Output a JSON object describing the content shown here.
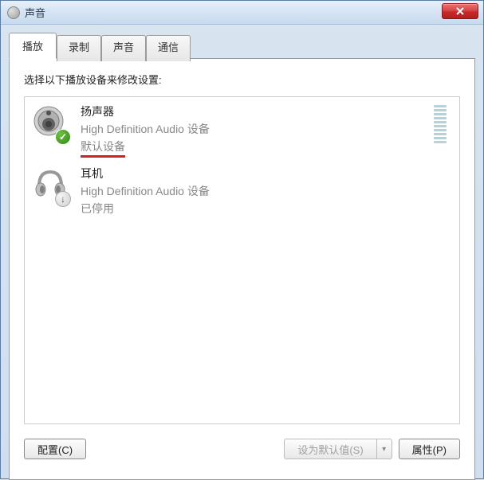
{
  "window": {
    "title": "声音"
  },
  "tabs": [
    {
      "label": "播放",
      "active": true
    },
    {
      "label": "录制",
      "active": false
    },
    {
      "label": "声音",
      "active": false
    },
    {
      "label": "通信",
      "active": false
    }
  ],
  "instruction": "选择以下播放设备来修改设置:",
  "devices": [
    {
      "name": "扬声器",
      "description": "High Definition Audio 设备",
      "status": "默认设备",
      "status_highlight": true,
      "badge": "check",
      "icon": "speaker",
      "show_meter": true
    },
    {
      "name": "耳机",
      "description": "High Definition Audio 设备",
      "status": "已停用",
      "status_highlight": false,
      "badge": "down",
      "icon": "headphones",
      "show_meter": false
    }
  ],
  "buttons": {
    "configure": "配置(C)",
    "set_default": "设为默认值(S)",
    "properties": "属性(P)"
  }
}
